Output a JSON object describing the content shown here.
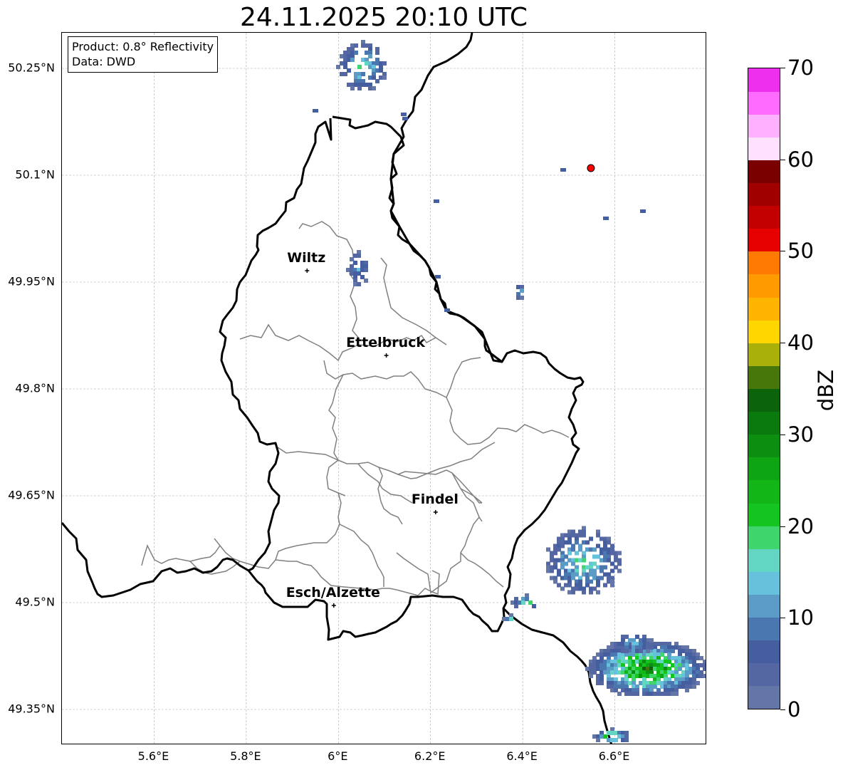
{
  "title": "24.11.2025 20:10 UTC",
  "info": {
    "product": "Product: 0.8° Reflectivity",
    "source": "Data: DWD"
  },
  "axes": {
    "lat_labels": [
      "50.25°N",
      "50.1°N",
      "49.95°N",
      "49.8°N",
      "49.65°N",
      "49.5°N",
      "49.35°N"
    ],
    "lat_values": [
      50.25,
      50.1,
      49.95,
      49.8,
      49.65,
      49.5,
      49.35
    ],
    "lon_labels": [
      "5.6°E",
      "5.8°E",
      "6°E",
      "6.2°E",
      "6.4°E",
      "6.6°E"
    ],
    "lon_values": [
      5.6,
      5.8,
      6.0,
      6.2,
      6.4,
      6.6
    ],
    "lat_range": [
      49.3,
      50.3
    ],
    "lon_range": [
      5.4,
      6.8
    ]
  },
  "cities": [
    {
      "name": "Wiltz",
      "lat": 49.966,
      "lon": 5.932
    },
    {
      "name": "Ettelbruck",
      "lat": 49.847,
      "lon": 6.104
    },
    {
      "name": "Findel",
      "lat": 49.627,
      "lon": 6.211
    },
    {
      "name": "Esch/Alzette",
      "lat": 49.496,
      "lon": 5.99
    }
  ],
  "radar_site": {
    "lat": 50.11,
    "lon": 6.548,
    "color": "#ff0000"
  },
  "colorbar": {
    "label": "dBZ",
    "min": 0,
    "max": 70,
    "ticks": [
      0,
      10,
      20,
      30,
      40,
      50,
      60,
      70
    ],
    "colors": [
      "#6476a8",
      "#5567a2",
      "#445ea0",
      "#4b77b0",
      "#5a9cc6",
      "#66c2dc",
      "#62d6c2",
      "#3ed56c",
      "#15c51f",
      "#12b616",
      "#0ea512",
      "#0c8f10",
      "#0b7a0e",
      "#0b640c",
      "#47760a",
      "#aab00a",
      "#ffd600",
      "#ffb400",
      "#ff9a00",
      "#ff7a00",
      "#e60000",
      "#c20000",
      "#a00000",
      "#7a0000",
      "#ffe0ff",
      "#ffb0ff",
      "#ff6aff",
      "#ee2fee"
    ]
  }
}
